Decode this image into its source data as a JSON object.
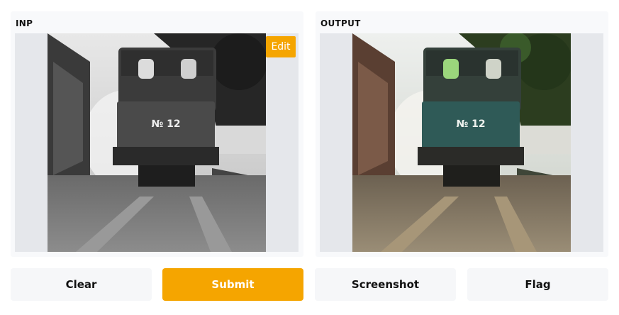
{
  "input_panel": {
    "label": "INP",
    "edit_label": "Edit",
    "plate_text": "№ 12"
  },
  "output_panel": {
    "label": "OUTPUT",
    "plate_text": "№ 12"
  },
  "buttons": {
    "clear": "Clear",
    "submit": "Submit",
    "screenshot": "Screenshot",
    "flag": "Flag"
  },
  "colors": {
    "accent": "#f5a500",
    "panel_bg": "#f8f9fb",
    "image_frame_bg": "#e5e7eb",
    "button_bg": "#f6f7f9"
  }
}
